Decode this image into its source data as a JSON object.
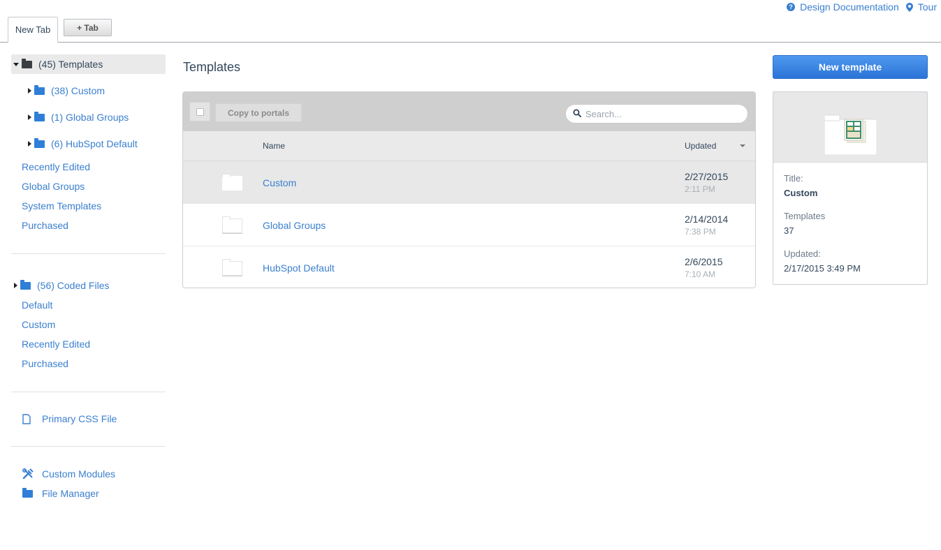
{
  "top_links": {
    "docs_label": "Design Documentation",
    "tour_label": "Tour"
  },
  "tabs": {
    "active_label": "New Tab",
    "add_label": "+ Tab"
  },
  "sidebar": {
    "root": "(45) Templates",
    "children": [
      {
        "label": "(38) Custom"
      },
      {
        "label": "(1) Global Groups"
      },
      {
        "label": "(6) HubSpot Default"
      }
    ],
    "template_links": [
      "Recently Edited",
      "Global Groups",
      "System Templates",
      "Purchased"
    ],
    "coded_root": "(56) Coded Files",
    "coded_links": [
      "Default",
      "Custom",
      "Recently Edited",
      "Purchased"
    ],
    "css_file": "Primary CSS File",
    "custom_modules": "Custom Modules",
    "file_manager": "File Manager"
  },
  "main": {
    "title": "Templates",
    "copy_button": "Copy to portals",
    "search_placeholder": "Search...",
    "columns": {
      "name": "Name",
      "updated": "Updated"
    },
    "rows": [
      {
        "name": "Custom",
        "date": "2/27/2015",
        "time": "2:11 PM"
      },
      {
        "name": "Global Groups",
        "date": "2/14/2014",
        "time": "7:38 PM"
      },
      {
        "name": "HubSpot Default",
        "date": "2/6/2015",
        "time": "7:10 AM"
      }
    ]
  },
  "details": {
    "new_button": "New template",
    "title_label": "Title:",
    "title_value": "Custom",
    "templates_label": "Templates",
    "templates_value": "37",
    "updated_label": "Updated:",
    "updated_value": "2/17/2015 3:49 PM"
  },
  "colors": {
    "link": "#3a7fcf",
    "primary_button": "#2b74d8",
    "folder": "#2f7fd8"
  }
}
